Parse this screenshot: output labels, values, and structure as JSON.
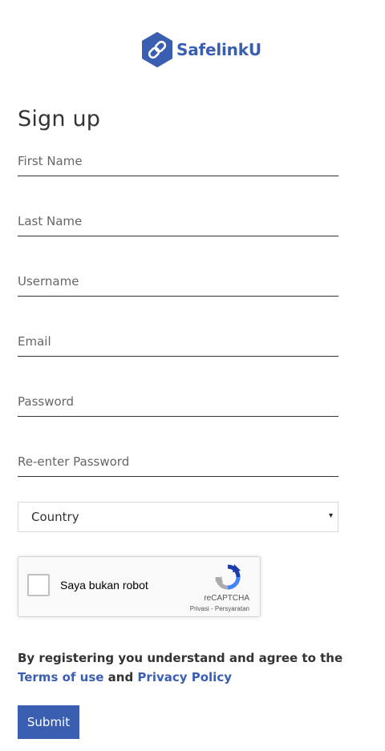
{
  "brand": {
    "name": "SafelinkU",
    "logo_icon": "chain-link-hexagon-icon",
    "color": "#3b5fb0"
  },
  "page": {
    "title": "Sign up"
  },
  "form": {
    "first_name": {
      "placeholder": "First Name",
      "value": ""
    },
    "last_name": {
      "placeholder": "Last Name",
      "value": ""
    },
    "username": {
      "placeholder": "Username",
      "value": ""
    },
    "email": {
      "placeholder": "Email",
      "value": ""
    },
    "password": {
      "placeholder": "Password",
      "value": ""
    },
    "confirm_password": {
      "placeholder": "Re-enter Password",
      "value": ""
    },
    "country": {
      "selected": "Country",
      "caret": "▾"
    }
  },
  "recaptcha": {
    "checkbox_label": "Saya bukan robot",
    "checked": false,
    "brand": "reCAPTCHA",
    "privacy_label": "Privasi",
    "separator": " - ",
    "terms_label": "Persyaratan"
  },
  "agreement": {
    "text_before": "By registering you understand and agree to the ",
    "terms_link": "Terms of use",
    "conjunction": " and ",
    "privacy_link": "Privacy Policy"
  },
  "actions": {
    "submit_label": "Submit"
  },
  "colors": {
    "accent": "#3b5fb0",
    "text": "#333333",
    "input_border": "#333333"
  }
}
